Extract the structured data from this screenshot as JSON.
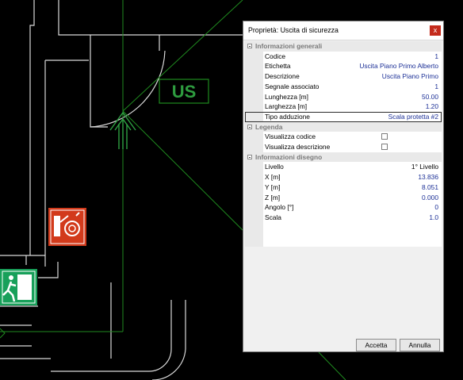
{
  "canvas": {
    "us_sign_text": "US",
    "line_color": "#1f8a1f",
    "sign_red": "#d23a1b",
    "sign_green": "#18a05a"
  },
  "dialog": {
    "title": "Proprietà: Uscita di sicurezza",
    "close_symbol": "x",
    "sections": [
      {
        "name": "Informazioni generali",
        "rows": [
          {
            "label": "Codice",
            "value": "1"
          },
          {
            "label": "Etichetta",
            "value": "Uscita Piano Primo Alberto"
          },
          {
            "label": "Descrizione",
            "value": "Uscita Piano Primo"
          },
          {
            "label": "Segnale associato",
            "value": "1"
          },
          {
            "label": "Lunghezza [m]",
            "value": "50.00"
          },
          {
            "label": "Larghezza [m]",
            "value": "1.20"
          },
          {
            "label": "Tipo adduzione",
            "value": "Scala protetta #2"
          }
        ]
      },
      {
        "name": "Legenda",
        "rows": [
          {
            "label": "Visualizza codice",
            "checked": false
          },
          {
            "label": "Visualizza descrizione",
            "checked": false
          }
        ]
      },
      {
        "name": "Informazioni disegno",
        "rows": [
          {
            "label": "Livello",
            "value": "1° Livello"
          },
          {
            "label": "X [m]",
            "value": "13.836"
          },
          {
            "label": "Y [m]",
            "value": "8.051"
          },
          {
            "label": "Z [m]",
            "value": "0.000"
          },
          {
            "label": "Angolo [°]",
            "value": "0"
          },
          {
            "label": "Scala",
            "value": "1.0"
          }
        ]
      }
    ],
    "ok_label": "Accetta",
    "cancel_label": "Annulla"
  }
}
